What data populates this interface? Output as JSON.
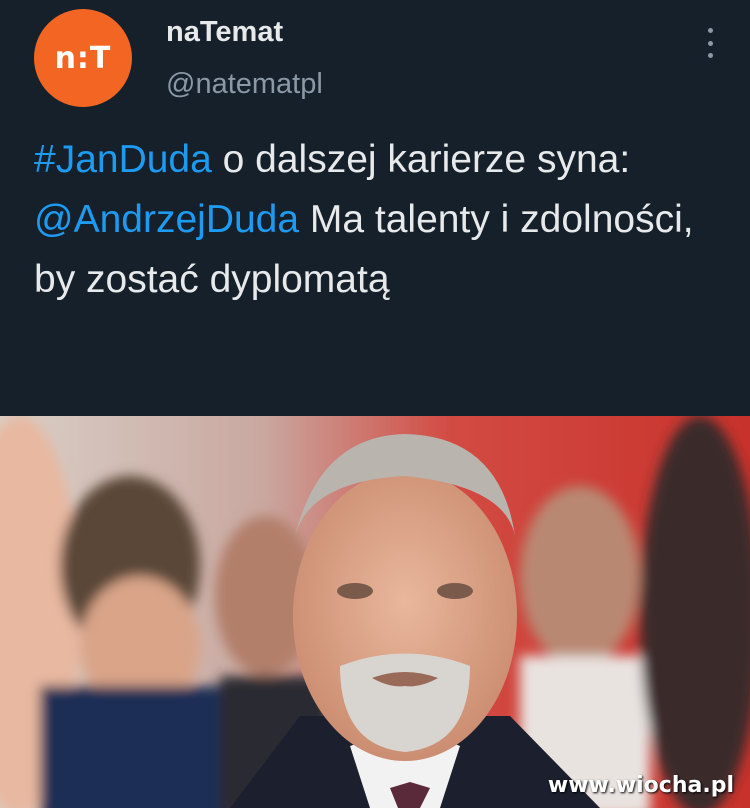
{
  "account": {
    "avatar_text": "n:T",
    "name": "naTemat",
    "handle": "@natematpl",
    "avatar_color": "#f26522"
  },
  "tweet": {
    "hashtag": "#JanDuda",
    "text_part1": " o dalszej karierze syna: ",
    "mention": "@AndrzejDuda",
    "text_part2": " Ma talenty i zdolności, by zostać dyplomatą"
  },
  "photo": {
    "watermark": "www.wiocha.pl"
  },
  "colors": {
    "background": "#15202b",
    "link": "#1d9bf0",
    "text": "#e7e9ea",
    "secondary": "#8b98a5"
  }
}
